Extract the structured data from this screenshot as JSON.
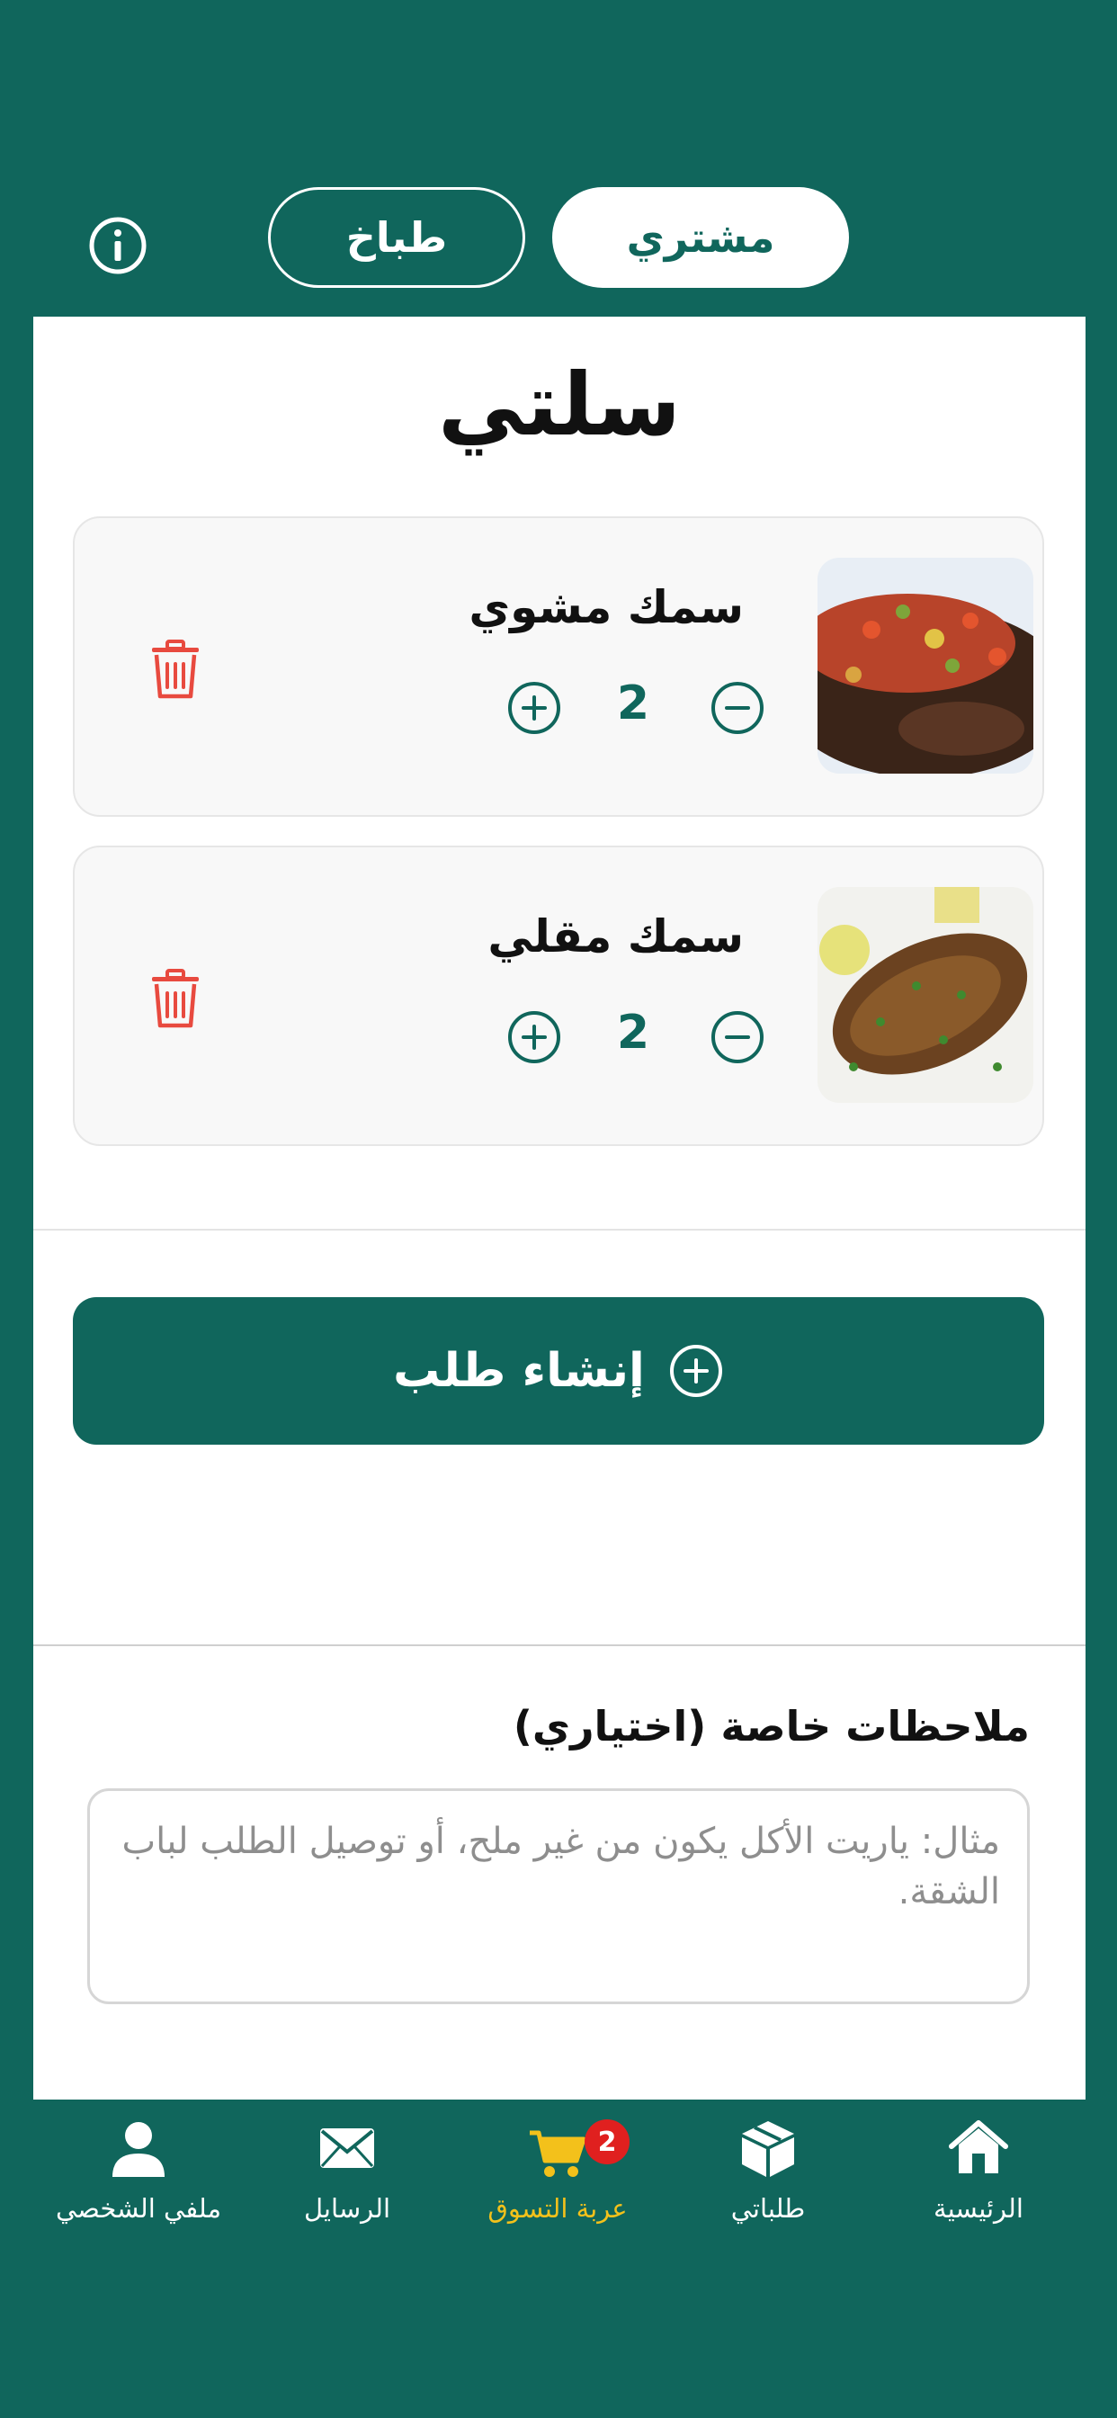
{
  "header": {
    "info_icon": "info-circle-icon",
    "cook_tab_label": "طباخ",
    "buyer_tab_label": "مشتري",
    "active_tab": "مشتري"
  },
  "cart": {
    "title": "سلتي",
    "items": [
      {
        "name": "سمك مشوي",
        "quantity": "2",
        "image": "grilled-fish-photo"
      },
      {
        "name": "سمك مقلي",
        "quantity": "2",
        "image": "fried-fish-photo"
      }
    ],
    "create_order_label": "إنشاء طلب",
    "notes_label": "ملاحظات خاصة (اختياري)",
    "notes_placeholder": "مثال: ياريت الأكل يكون من غير ملح، أو توصيل الطلب لباب الشقة.",
    "notes_value": ""
  },
  "bottom_nav": {
    "items": [
      {
        "label": "ملفي الشخصي",
        "icon": "user-icon"
      },
      {
        "label": "الرسايل",
        "icon": "envelope-icon"
      },
      {
        "label": "عربة التسوق",
        "icon": "cart-icon",
        "badge": "2",
        "active": true
      },
      {
        "label": "طلباتي",
        "icon": "box-icon"
      },
      {
        "label": "الرئيسية",
        "icon": "home-icon"
      }
    ]
  },
  "colors": {
    "primary": "#10665C",
    "accent_active": "#F3C11B",
    "delete": "#E84A3F",
    "badge": "#E0201F"
  }
}
